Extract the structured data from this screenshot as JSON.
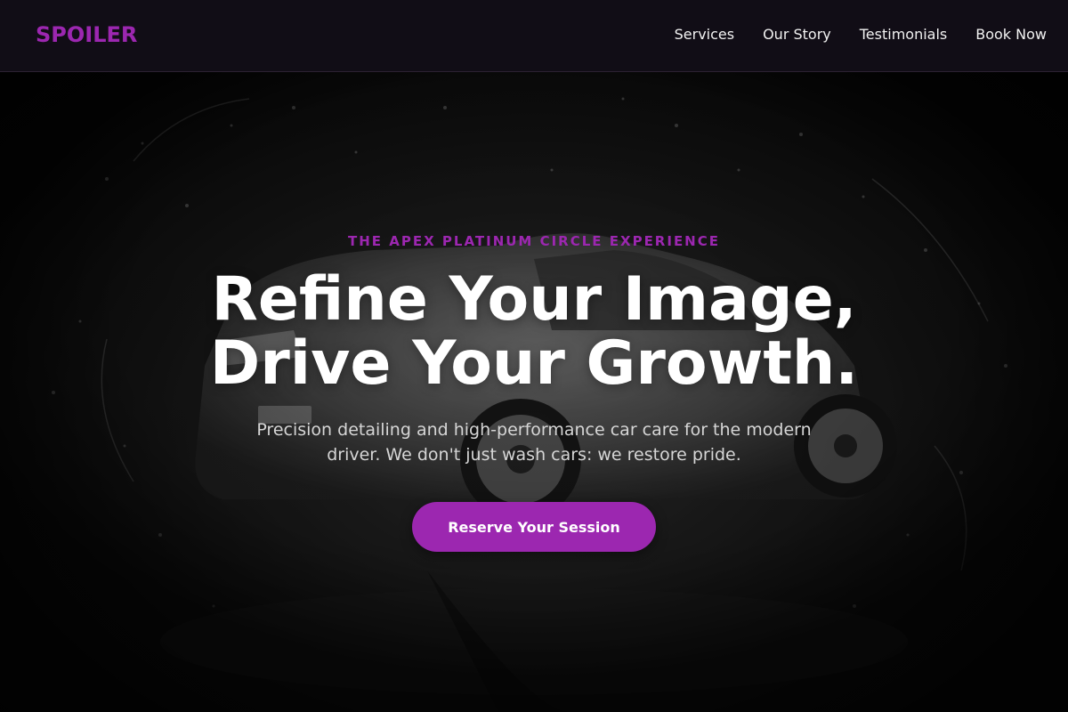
{
  "brand": {
    "name": "SPOILER",
    "accent_color": "#9c27b0"
  },
  "nav": {
    "links": [
      {
        "label": "Services"
      },
      {
        "label": "Our Story"
      },
      {
        "label": "Testimonials"
      },
      {
        "label": "Book Now"
      }
    ]
  },
  "hero": {
    "eyebrow": "THE APEX PLATINUM CIRCLE EXPERIENCE",
    "headline_line1": "Refine Your Image,",
    "headline_line2": "Drive Your Growth.",
    "subtext": "Precision detailing and high-performance car care for the modern driver. We don't just wash cars: we restore pride.",
    "cta_label": "Reserve Your Session",
    "background": "car-water-splash-image"
  }
}
